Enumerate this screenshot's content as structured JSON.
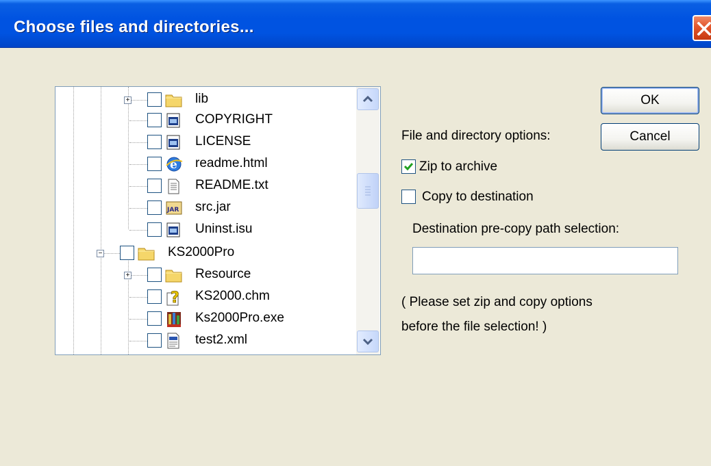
{
  "window": {
    "title": "Choose files and directories...",
    "close_icon": "close-icon"
  },
  "tree": {
    "items": [
      {
        "label": "lib",
        "icon": "folder-icon",
        "expander": "+",
        "checked": false
      },
      {
        "label": "COPYRIGHT",
        "icon": "file-icon",
        "checked": false
      },
      {
        "label": "LICENSE",
        "icon": "file-icon",
        "checked": false
      },
      {
        "label": "readme.html",
        "icon": "ie-html-icon",
        "checked": false
      },
      {
        "label": "README.txt",
        "icon": "text-file-icon",
        "checked": false
      },
      {
        "label": "src.jar",
        "icon": "jar-icon",
        "checked": false
      },
      {
        "label": "Uninst.isu",
        "icon": "file-icon",
        "checked": false
      },
      {
        "label": "KS2000Pro",
        "icon": "folder-icon",
        "expander": "−",
        "checked": false
      },
      {
        "label": "Resource",
        "icon": "folder-icon",
        "expander": "+",
        "checked": false
      },
      {
        "label": "KS2000.chm",
        "icon": "help-file-icon",
        "checked": false
      },
      {
        "label": "Ks2000Pro.exe",
        "icon": "exe-icon",
        "checked": false
      },
      {
        "label": "test2.xml",
        "icon": "xml-file-icon",
        "checked": false
      }
    ]
  },
  "buttons": {
    "ok": "OK",
    "cancel": "Cancel"
  },
  "options": {
    "heading": "File and directory options:",
    "zip_label": "Zip to archive",
    "zip_checked": true,
    "copy_label": "Copy to destination",
    "copy_checked": false,
    "dest_label": "Destination pre-copy path selection:",
    "dest_value": "",
    "note_line1": "( Please set zip and copy options",
    "note_line2": "before the file selection! )"
  }
}
